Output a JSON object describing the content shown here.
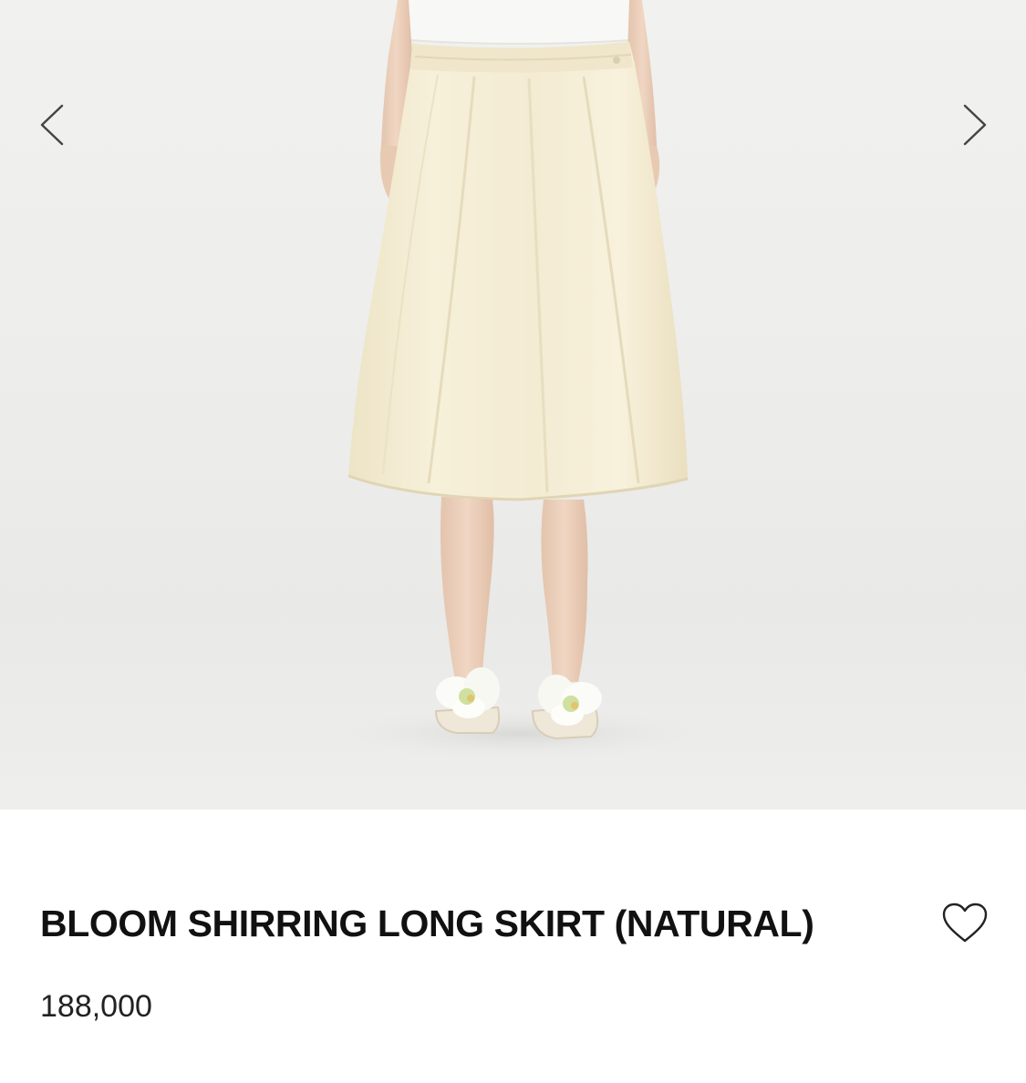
{
  "gallery": {
    "image_description_icon": "product-model-photo",
    "prev_icon": "chevron-left-icon",
    "next_icon": "chevron-right-icon"
  },
  "product": {
    "title": "BLOOM SHIRRING LONG SKIRT (NATURAL)",
    "price": "188,000",
    "wishlist_icon": "heart-outline-icon"
  },
  "colors": {
    "background": "#ffffff",
    "text": "#111111",
    "skirt": "#f5edd6",
    "photo_bg": "#eeeeec"
  }
}
